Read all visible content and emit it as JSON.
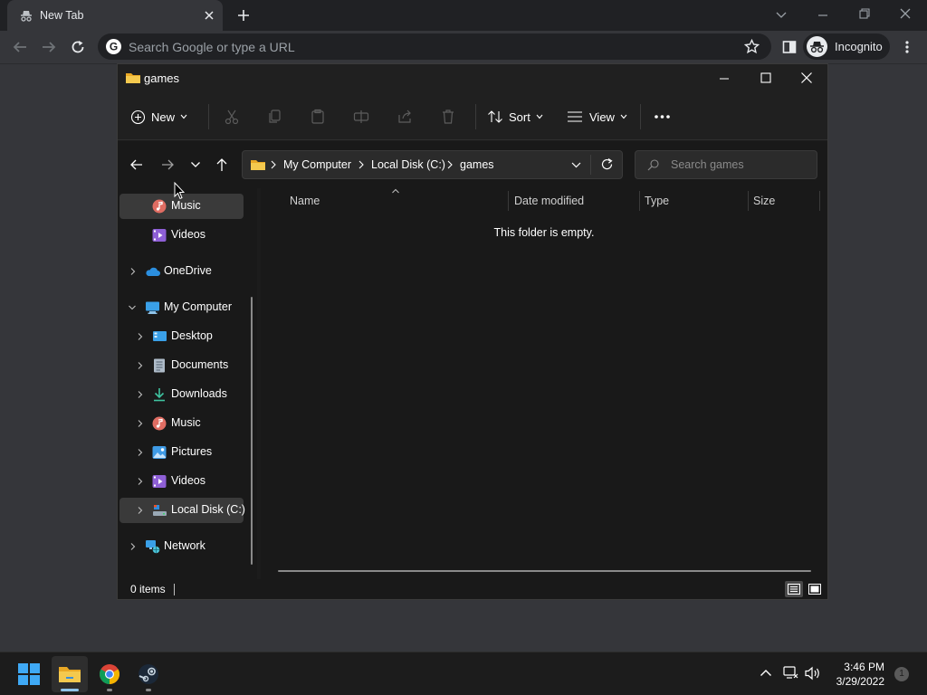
{
  "browser": {
    "tab_title": "New Tab",
    "omnibox_placeholder": "Search Google or type a URL",
    "profile_label": "Incognito"
  },
  "explorer": {
    "window_title": "games",
    "commands": {
      "new_label": "New",
      "sort_label": "Sort",
      "view_label": "View"
    },
    "breadcrumb": [
      "My Computer",
      "Local Disk (C:)",
      "games"
    ],
    "search_placeholder": "Search games",
    "sidebar": [
      {
        "label": "Music",
        "icon": "music-icon",
        "selected": true
      },
      {
        "label": "Videos",
        "icon": "videos-icon"
      },
      {
        "label": "OneDrive",
        "icon": "onedrive-icon"
      },
      {
        "label": "My Computer",
        "icon": "computer-icon",
        "expanded": true
      },
      {
        "label": "Desktop",
        "icon": "desktop-icon"
      },
      {
        "label": "Documents",
        "icon": "documents-icon"
      },
      {
        "label": "Downloads",
        "icon": "downloads-icon"
      },
      {
        "label": "Music",
        "icon": "music-icon"
      },
      {
        "label": "Pictures",
        "icon": "pictures-icon"
      },
      {
        "label": "Videos",
        "icon": "videos-icon"
      },
      {
        "label": "Local Disk (C:)",
        "icon": "drive-icon",
        "selected": true
      },
      {
        "label": "Network",
        "icon": "network-icon"
      }
    ],
    "columns": [
      "Name",
      "Date modified",
      "Type",
      "Size"
    ],
    "empty_message": "This folder is empty.",
    "status_text": "0 items"
  },
  "taskbar": {
    "time": "3:46 PM",
    "date": "3/29/2022",
    "notification_count": "1"
  },
  "colors": {
    "accent_blue": "#0078d4",
    "folder_yellow": "#f4c94e",
    "explorer_bg": "#191919"
  }
}
